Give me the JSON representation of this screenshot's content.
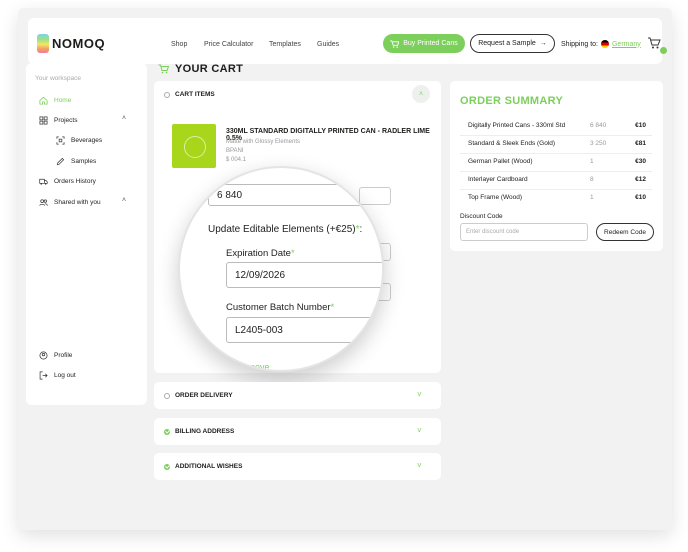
{
  "brand": {
    "name": "NOMOQ"
  },
  "nav": [
    "Shop",
    "Price Calculator",
    "Templates",
    "Guides"
  ],
  "header": {
    "buy_label": "Buy Printed Cans",
    "sample_label": "Request a Sample",
    "shipping_label": "Shipping to:",
    "shipping_country": "Germany"
  },
  "sidebar": {
    "workspace_label": "Your workspace",
    "items": [
      "Home",
      "Projects",
      "Beverages",
      "Samples",
      "Orders History",
      "Shared with you",
      "Profile",
      "Log out"
    ]
  },
  "cart": {
    "title": "YOUR CART",
    "sections": [
      "CART ITEMS",
      "ORDER DELIVERY",
      "BILLING ADDRESS",
      "ADDITIONAL WISHES"
    ],
    "item": {
      "title": "330ML STANDARD DIGITALLY PRINTED CAN - RADLER LIME 0.5%",
      "finish": "Matte with Glossy Elements",
      "code": "BPANI",
      "price": "$ 004.1"
    },
    "magnified": {
      "quantity_value": "6 840",
      "heading": "Update Editable Elements (+€25)",
      "heading_suffix": ":",
      "expiration_label": "Expiration Date",
      "expiration_value": "12/09/2026",
      "batch_label": "Customer Batch Number",
      "batch_value": "L2405-003",
      "required_mark": "*",
      "remove_label": "Remove"
    }
  },
  "summary": {
    "title": "ORDER SUMMARY",
    "rows": [
      {
        "name": "Digitally Printed Cans - 330ml Std",
        "qty": "6 840",
        "price": "€10"
      },
      {
        "name": "Standard & Sleek Ends (Gold)",
        "qty": "3 250",
        "price": "€81"
      },
      {
        "name": "German Pallet (Wood)",
        "qty": "1",
        "price": "€30"
      },
      {
        "name": "Interlayer Cardboard",
        "qty": "8",
        "price": "€12"
      },
      {
        "name": "Top Frame (Wood)",
        "qty": "1",
        "price": "€10"
      }
    ],
    "discount_label": "Discount Code",
    "discount_placeholder": "Enter discount code",
    "redeem_label": "Redeem Code"
  },
  "colors": {
    "accent": "#7ccf5b",
    "background": "#f2f2f2",
    "text": "#1d1d1b"
  }
}
